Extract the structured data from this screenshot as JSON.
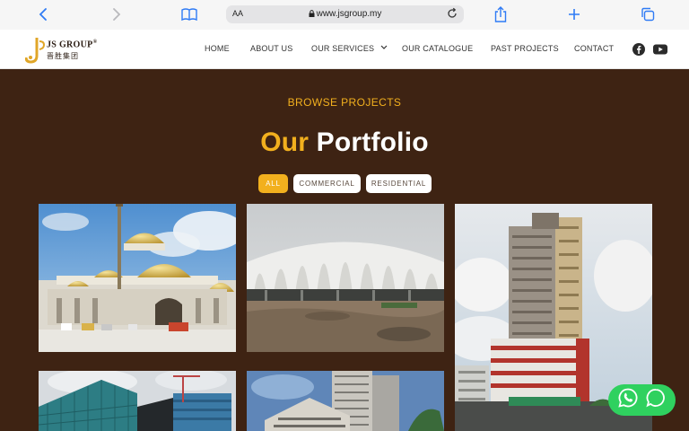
{
  "browser": {
    "text_size_label": "AA",
    "url": "www.jsgroup.my"
  },
  "brand": {
    "name": "JS GROUP",
    "mark": "®",
    "chinese": "晋胜集团",
    "accent": "#f2b01e"
  },
  "nav": {
    "home": "HOME",
    "about": "ABOUT US",
    "services": "OUR SERVICES",
    "catalogue": "OUR CATALOGUE",
    "past_projects": "PAST PROJECTS",
    "contact": "CONTACT"
  },
  "portfolio": {
    "eyebrow": "BROWSE PROJECTS",
    "title_highlight": "Our",
    "title_rest": "Portfolio",
    "filters": {
      "all": "ALL",
      "commercial": "COMMERCIAL",
      "residential": "RESIDENTIAL"
    },
    "active_filter": "ALL"
  },
  "colors": {
    "background": "#3e2313",
    "accent": "#f2b01e",
    "whatsapp": "#2fd15f"
  },
  "icons": [
    "back-icon",
    "forward-icon",
    "bookmarks-icon",
    "lock-icon",
    "reload-icon",
    "share-icon",
    "new-tab-icon",
    "tabs-icon",
    "facebook-icon",
    "youtube-icon",
    "whatsapp-icon",
    "chat-icon"
  ]
}
